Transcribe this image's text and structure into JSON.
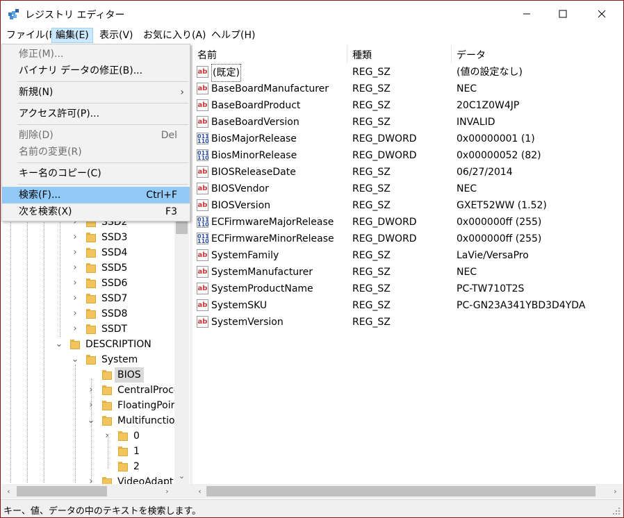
{
  "window": {
    "title": "レジストリ エディター",
    "controls": {
      "minimize": "—",
      "maximize": "☐",
      "close": "✕"
    }
  },
  "menubar": {
    "items": [
      {
        "label": "ファイル(F)"
      },
      {
        "label": "編集(E)",
        "active": true
      },
      {
        "label": "表示(V)"
      },
      {
        "label": "お気に入り(A)"
      },
      {
        "label": "ヘルプ(H)"
      }
    ]
  },
  "edit_menu": {
    "items": [
      {
        "label": "修正(M)...",
        "disabled": true
      },
      {
        "label": "バイナリ データの修正(B)...",
        "disabled": false
      },
      {
        "label": "新規(N)",
        "submenu": true
      },
      {
        "label": "アクセス許可(P)..."
      },
      {
        "label": "削除(D)",
        "shortcut": "Del",
        "disabled": true
      },
      {
        "label": "名前の変更(R)",
        "disabled": true
      },
      {
        "label": "キー名のコピー(C)"
      },
      {
        "label": "検索(F)...",
        "shortcut": "Ctrl+F",
        "highlighted": true
      },
      {
        "label": "次を検索(X)",
        "shortcut": "F3"
      }
    ],
    "submenu_arrow": "›"
  },
  "tree": {
    "items": [
      {
        "label": "SSD2",
        "expander": "›"
      },
      {
        "label": "SSD3",
        "expander": "›"
      },
      {
        "label": "SSD4",
        "expander": "›"
      },
      {
        "label": "SSD5",
        "expander": "›"
      },
      {
        "label": "SSD6",
        "expander": "›"
      },
      {
        "label": "SSD7",
        "expander": "›"
      },
      {
        "label": "SSD8",
        "expander": "›"
      },
      {
        "label": "SSDT",
        "expander": "›"
      },
      {
        "label": "DESCRIPTION",
        "expander": "⌄"
      },
      {
        "label": "System",
        "expander": "⌄"
      },
      {
        "label": "BIOS",
        "expander": "",
        "selected": true
      },
      {
        "label": "CentralProce",
        "expander": "›"
      },
      {
        "label": "FloatingPoir",
        "expander": "›"
      },
      {
        "label": "Multifunctio",
        "expander": "⌄"
      },
      {
        "label": "0",
        "expander": "›"
      },
      {
        "label": "1",
        "expander": ""
      },
      {
        "label": "2",
        "expander": ""
      },
      {
        "label": "VideoAdapt",
        "expander": "›"
      }
    ]
  },
  "list": {
    "columns": [
      "名前",
      "種類",
      "データ"
    ],
    "rows": [
      {
        "icon": "string-value-icon",
        "name": "(既定)",
        "type": "REG_SZ",
        "data": "(値の設定なし)"
      },
      {
        "icon": "string-value-icon",
        "name": "BaseBoardManufacturer",
        "type": "REG_SZ",
        "data": "NEC"
      },
      {
        "icon": "string-value-icon",
        "name": "BaseBoardProduct",
        "type": "REG_SZ",
        "data": "20C1Z0W4JP"
      },
      {
        "icon": "string-value-icon",
        "name": "BaseBoardVersion",
        "type": "REG_SZ",
        "data": "INVALID"
      },
      {
        "icon": "binary-value-icon",
        "name": "BiosMajorRelease",
        "type": "REG_DWORD",
        "data": "0x00000001 (1)"
      },
      {
        "icon": "binary-value-icon",
        "name": "BiosMinorRelease",
        "type": "REG_DWORD",
        "data": "0x00000052 (82)"
      },
      {
        "icon": "string-value-icon",
        "name": "BIOSReleaseDate",
        "type": "REG_SZ",
        "data": "06/27/2014"
      },
      {
        "icon": "string-value-icon",
        "name": "BIOSVendor",
        "type": "REG_SZ",
        "data": "NEC"
      },
      {
        "icon": "string-value-icon",
        "name": "BIOSVersion",
        "type": "REG_SZ",
        "data": "GXET52WW (1.52)"
      },
      {
        "icon": "binary-value-icon",
        "name": "ECFirmwareMajorRelease",
        "type": "REG_DWORD",
        "data": "0x000000ff (255)"
      },
      {
        "icon": "binary-value-icon",
        "name": "ECFirmwareMinorRelease",
        "type": "REG_DWORD",
        "data": "0x000000ff (255)"
      },
      {
        "icon": "string-value-icon",
        "name": "SystemFamily",
        "type": "REG_SZ",
        "data": "LaVie/VersaPro"
      },
      {
        "icon": "string-value-icon",
        "name": "SystemManufacturer",
        "type": "REG_SZ",
        "data": "NEC"
      },
      {
        "icon": "string-value-icon",
        "name": "SystemProductName",
        "type": "REG_SZ",
        "data": "PC-TW710T2S"
      },
      {
        "icon": "string-value-icon",
        "name": "SystemSKU",
        "type": "REG_SZ",
        "data": "PC-GN23A341YBD3D4YDA"
      },
      {
        "icon": "string-value-icon",
        "name": "SystemVersion",
        "type": "REG_SZ",
        "data": ""
      }
    ],
    "icon_glyphs": {
      "string": "ab",
      "binary": "011 110"
    }
  },
  "statusbar": {
    "text": "キー、値、データの中のテキストを検索します。"
  },
  "colors": {
    "menu_highlight": "#91c9f7",
    "menu_active": "#cce8ff",
    "folder": "#f2c55c",
    "selected_tree": "#d9d9d9"
  }
}
